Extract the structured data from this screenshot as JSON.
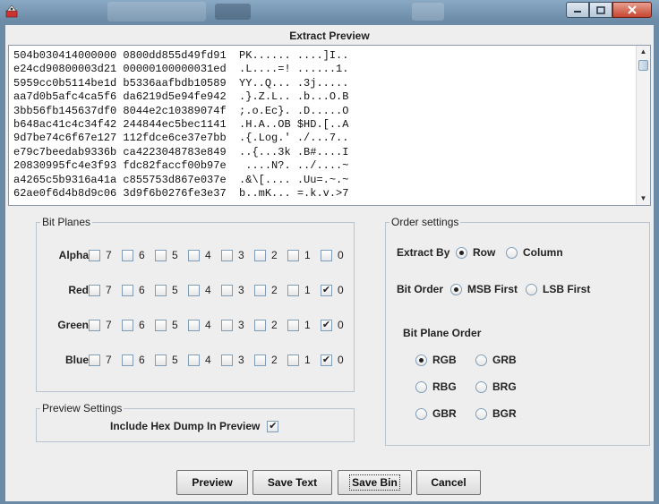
{
  "window": {
    "controls": [
      "minimize-icon",
      "maximize-icon",
      "close-icon"
    ],
    "app_icon": "app-icon"
  },
  "preview": {
    "title": "Extract Preview",
    "lines": [
      "504b030414000000 0800dd855d49fd91  PK...... ....]I..",
      "e24cd90800003d21 00000100000031ed  .L....=! ......1.",
      "5959cc0b5114be1d b5336aafbdb10589  YY..Q... .3j.....",
      "aa7d0b5afc4ca5f6 da6219d5e94fe942  .}.Z.L.. .b...O.B",
      "3bb56fb145637df0 8044e2c10389074f  ;.o.Ec}. .D.....O",
      "b648ac41c4c34f42 244844ec5bec1141  .H.A..OB $HD.[..A",
      "9d7be74c6f67e127 112fdce6ce37e7bb  .{.Log.' ./...7..",
      "e79c7beedab9336b ca4223048783e849  ..{...3k .B#....I",
      "20830995fc4e3f93 fdc82faccf00b97e   ....N?. ../....~",
      "a4265c5b9316a41a c855753d867e037e  .&\\[.... .Uu=.~.~",
      "62ae0f6d4b8d9c06 3d9f6b0276fe3e37  b..mK... =.k.v.>7"
    ]
  },
  "bit_planes": {
    "title": "Bit Planes",
    "bits": [
      "7",
      "6",
      "5",
      "4",
      "3",
      "2",
      "1",
      "0"
    ],
    "rows": [
      {
        "label": "Alpha",
        "checked": [
          false,
          false,
          false,
          false,
          false,
          false,
          false,
          false
        ]
      },
      {
        "label": "Red",
        "checked": [
          false,
          false,
          false,
          false,
          false,
          false,
          false,
          true
        ]
      },
      {
        "label": "Green",
        "checked": [
          false,
          false,
          false,
          false,
          false,
          false,
          false,
          true
        ]
      },
      {
        "label": "Blue",
        "checked": [
          false,
          false,
          false,
          false,
          false,
          false,
          false,
          true
        ]
      }
    ]
  },
  "preview_settings": {
    "title": "Preview Settings",
    "include_hex_label": "Include Hex Dump In Preview",
    "include_hex_checked": true
  },
  "order_settings": {
    "title": "Order settings",
    "extract_by_label": "Extract By",
    "extract_by_options": [
      "Row",
      "Column"
    ],
    "extract_by_selected": "Row",
    "bit_order_label": "Bit Order",
    "bit_order_options": [
      "MSB First",
      "LSB First"
    ],
    "bit_order_selected": "MSB First",
    "plane_order_label": "Bit Plane Order",
    "plane_order_options": [
      "RGB",
      "GRB",
      "RBG",
      "BRG",
      "GBR",
      "BGR"
    ],
    "plane_order_selected": "RGB"
  },
  "buttons": {
    "preview": "Preview",
    "save_text": "Save Text",
    "save_bin": "Save Bin",
    "cancel": "Cancel"
  }
}
